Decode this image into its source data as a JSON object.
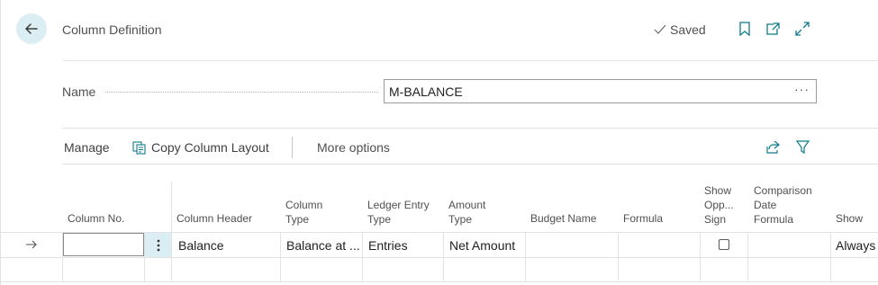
{
  "header": {
    "title": "Column Definition",
    "saved_label": "Saved"
  },
  "name_field": {
    "label": "Name",
    "value": "M-BALANCE",
    "more_label": "···"
  },
  "toolbar": {
    "manage": "Manage",
    "copy_layout": "Copy Column Layout",
    "more_options": "More options"
  },
  "columns": {
    "column_no": "Column No.",
    "column_header": "Column Header",
    "column_type": [
      "Column",
      "Type"
    ],
    "ledger_entry_type": [
      "Ledger Entry",
      "Type"
    ],
    "amount_type": [
      "Amount",
      "Type"
    ],
    "budget_name": "Budget Name",
    "formula": "Formula",
    "show_opp_sign": [
      "Show",
      "Opp...",
      "Sign"
    ],
    "comparison_date_formula": [
      "Comparison",
      "Date",
      "Formula"
    ],
    "show": "Show"
  },
  "rows": [
    {
      "column_no": "",
      "column_header": "Balance",
      "column_type": "Balance at ...",
      "ledger_entry_type": "Entries",
      "amount_type": "Net Amount",
      "budget_name": "",
      "formula": "",
      "show_opp_sign": false,
      "comparison_date_formula": "",
      "show": "Always"
    }
  ],
  "colors": {
    "accent": "#0f7b8a",
    "back_bg": "#dbeef3"
  }
}
